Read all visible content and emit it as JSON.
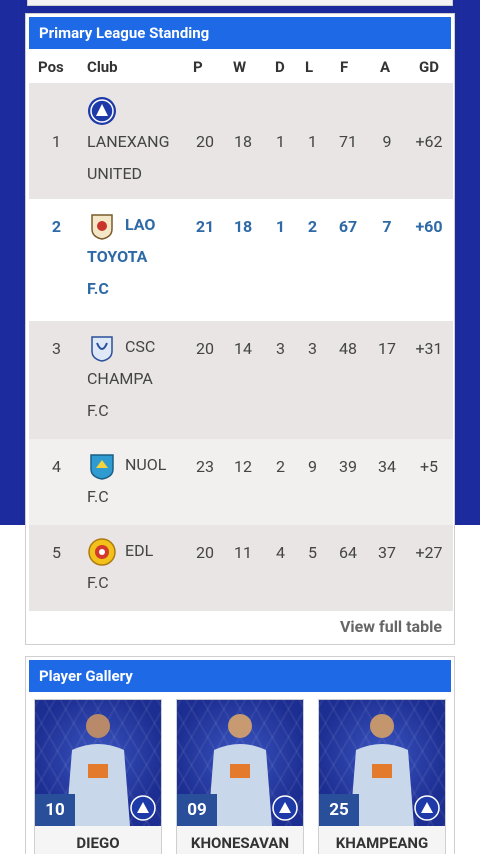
{
  "league": {
    "title": "Primary League Standing",
    "headers": [
      "Pos",
      "Club",
      "P",
      "W",
      "D",
      "L",
      "F",
      "A",
      "GD"
    ],
    "rows": [
      {
        "pos": "1",
        "club_line1": "",
        "club_rest": "LANEXANG UNITED",
        "p": "20",
        "w": "18",
        "d": "1",
        "l": "1",
        "f": "71",
        "a": "9",
        "gd": "+62",
        "logo": "lanexang-logo-icon"
      },
      {
        "pos": "2",
        "club_line1": "LAO",
        "club_rest": "TOYOTA F.C",
        "p": "21",
        "w": "18",
        "d": "1",
        "l": "2",
        "f": "67",
        "a": "7",
        "gd": "+60",
        "logo": "lao-toyota-logo-icon"
      },
      {
        "pos": "3",
        "club_line1": "CSC",
        "club_rest": "CHAMPA F.C",
        "p": "20",
        "w": "14",
        "d": "3",
        "l": "3",
        "f": "48",
        "a": "17",
        "gd": "+31",
        "logo": "csc-champa-logo-icon"
      },
      {
        "pos": "4",
        "club_line1": "NUOL",
        "club_rest": "F.C",
        "p": "23",
        "w": "12",
        "d": "2",
        "l": "9",
        "f": "39",
        "a": "34",
        "gd": "+5",
        "logo": "nuol-logo-icon"
      },
      {
        "pos": "5",
        "club_line1": "EDL",
        "club_rest": "F.C",
        "p": "20",
        "w": "11",
        "d": "4",
        "l": "5",
        "f": "64",
        "a": "37",
        "gd": "+27",
        "logo": "edl-logo-icon"
      }
    ],
    "view_full": "View full table"
  },
  "gallery": {
    "title": "Player Gallery",
    "players": [
      {
        "number": "10",
        "name": "DIEGO"
      },
      {
        "number": "09",
        "name": "KHONESAVAN"
      },
      {
        "number": "25",
        "name": "KHAMPEANG"
      }
    ]
  },
  "colors": {
    "header_blue": "#1e6ae6",
    "highlight_text": "#2e6aa6",
    "page_blue": "#1a2a9a"
  }
}
